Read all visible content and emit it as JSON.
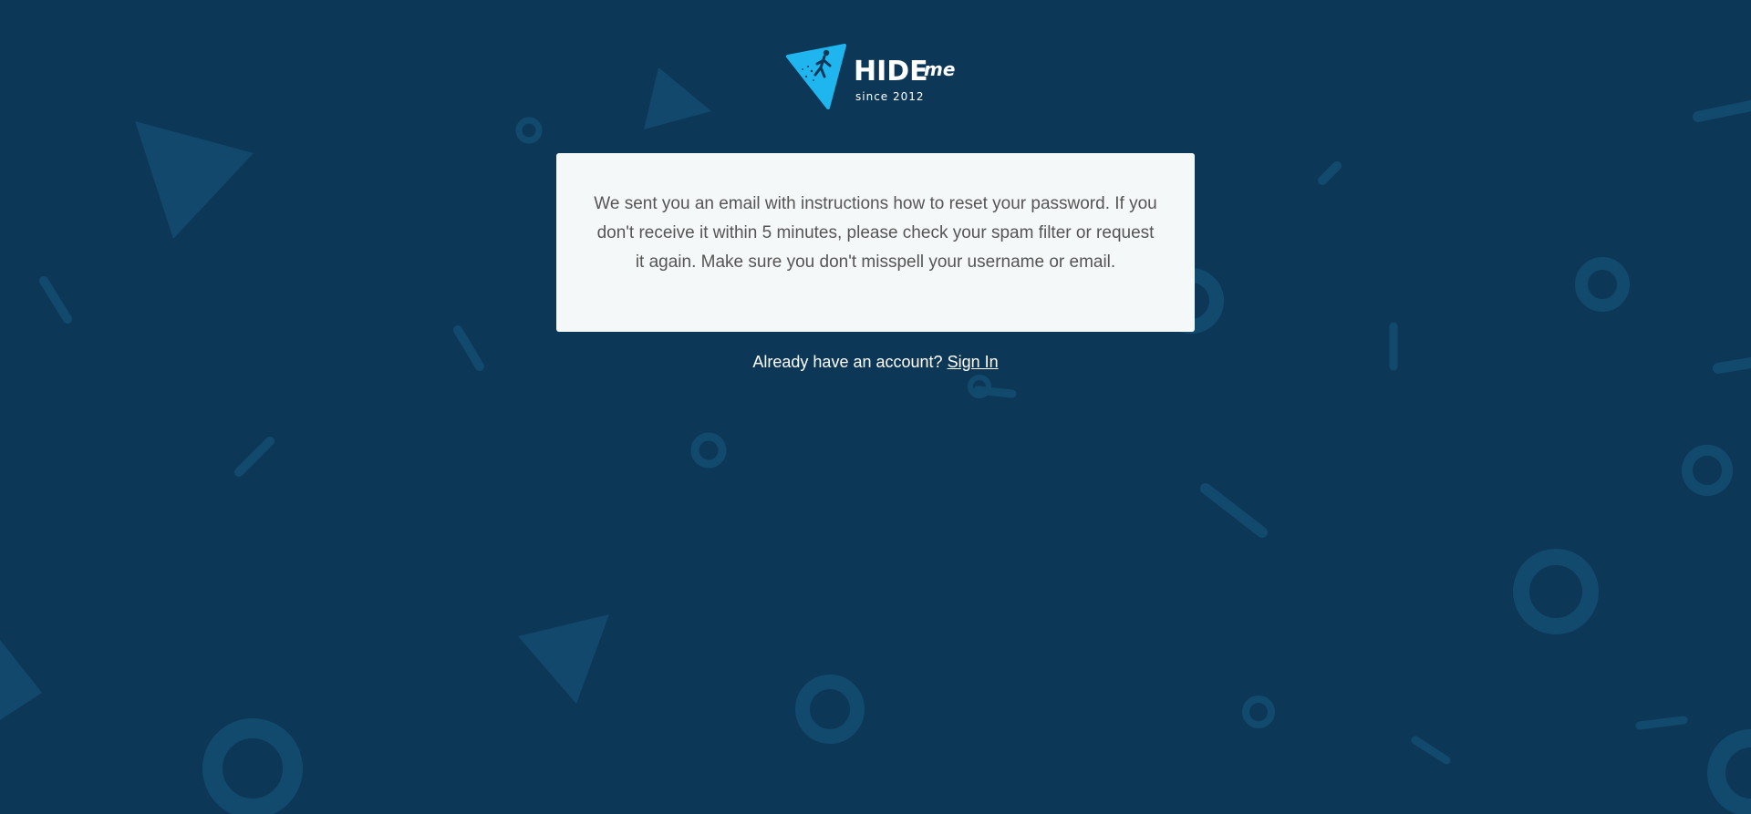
{
  "brand": {
    "name": "HIDE",
    "suffix": "me",
    "tagline": "since 2012",
    "accent_color": "#1fb6ef",
    "icon": "triangle-walker-logo-icon"
  },
  "message": {
    "text": "We sent you an email with instructions how to reset your password. If you don't receive it within 5 minutes, please check your spam filter or request it again. Make sure you don't misspell your username or email."
  },
  "footer": {
    "prompt": "Already have an account?",
    "link_label": "Sign In"
  },
  "colors": {
    "background": "#0d3757",
    "card": "#f5f8f9",
    "decoration": "#124a6e"
  }
}
